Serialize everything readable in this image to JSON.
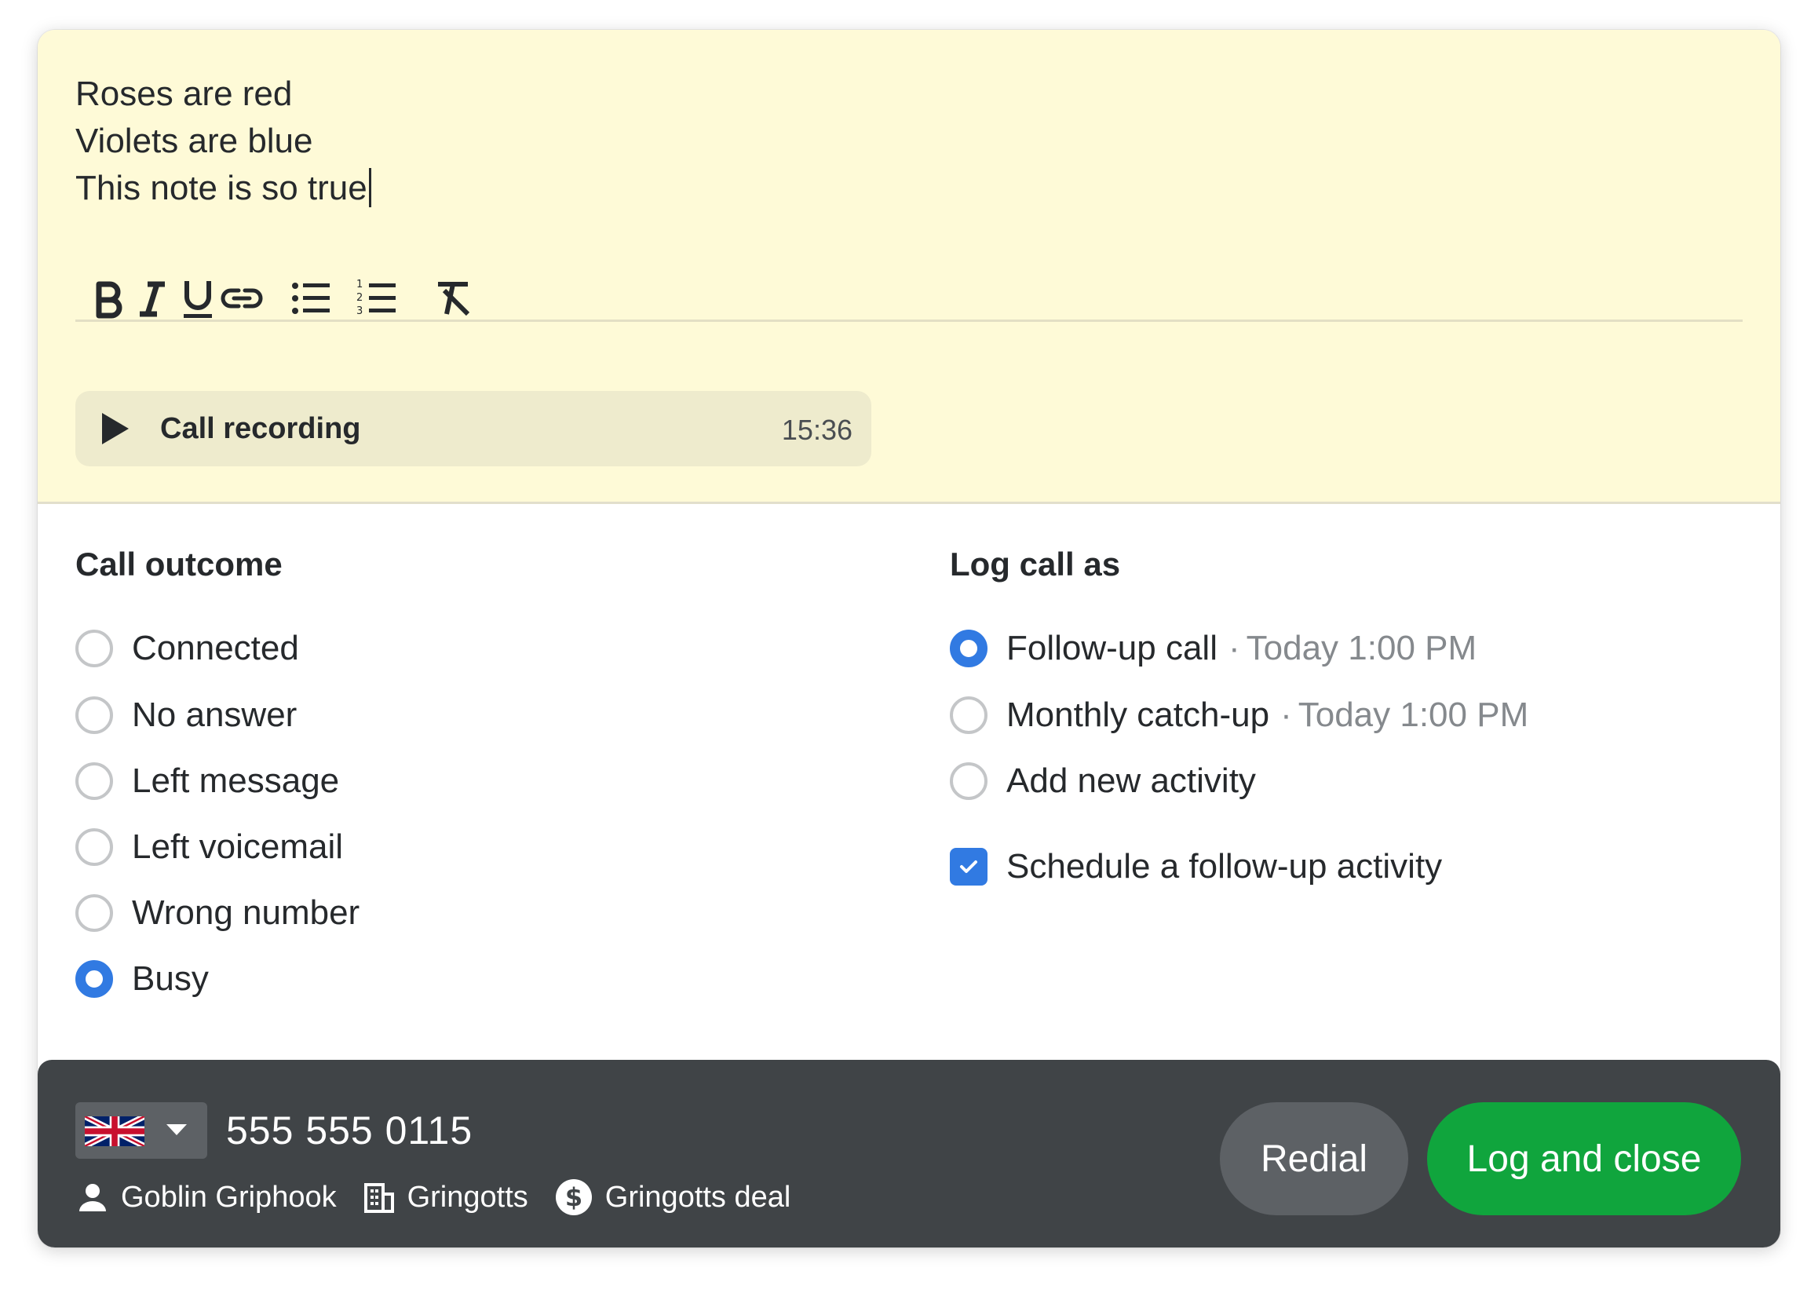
{
  "note": {
    "lines": [
      "Roses are red",
      "Violets are blue",
      "This note is so true"
    ]
  },
  "toolbar": {
    "icons": [
      "bold-icon",
      "italic-icon",
      "underline-icon",
      "link-icon",
      "bulleted-list-icon",
      "numbered-list-icon",
      "clear-formatting-icon"
    ]
  },
  "recording": {
    "label": "Call recording",
    "duration": "15:36"
  },
  "call_outcome": {
    "title": "Call outcome",
    "options": [
      "Connected",
      "No answer",
      "Left message",
      "Left voicemail",
      "Wrong number",
      "Busy"
    ],
    "selected": "Busy"
  },
  "log_call_as": {
    "title": "Log call as",
    "options": [
      {
        "label": "Follow-up call",
        "meta": "Today 1:00 PM"
      },
      {
        "label": "Monthly catch-up",
        "meta": "Today 1:00 PM"
      },
      {
        "label": "Add new activity"
      }
    ],
    "selected": "Follow-up call",
    "separator": "·",
    "schedule_label": "Schedule a follow-up activity",
    "schedule_checked": true
  },
  "footer": {
    "country_flag": "uk-flag-icon",
    "phone": "555 555 0115",
    "person": "Goblin Griphook",
    "organization": "Gringotts",
    "deal": "Gringotts deal",
    "redial_label": "Redial",
    "log_label": "Log and close"
  },
  "colors": {
    "note_bg": "#fefad7",
    "accent_blue": "#317ae2",
    "footer_bg": "#404447",
    "primary_green": "#10a53d"
  }
}
